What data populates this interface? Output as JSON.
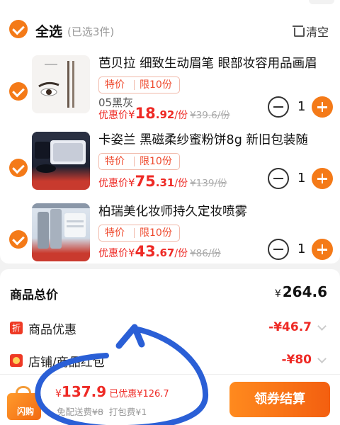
{
  "cart": {
    "select_all_label": "全选",
    "selected_count": "(已选3件)",
    "clear_label": "清空",
    "items": [
      {
        "title": "芭贝拉 细致生动眉笔 眼部妆容用品画眉",
        "tag_special": "特价",
        "tag_limit": "限10份",
        "variant": "05黑灰",
        "price_prefix": "优惠价",
        "yen": "¥",
        "price_int": "18",
        "price_dec": ".92",
        "unit": "/份",
        "original": "¥39.6/份",
        "quantity": "1"
      },
      {
        "title": "卡姿兰 黑磁柔纱蜜粉饼8g 新旧包装随",
        "tag_special": "特价",
        "tag_limit": "限10份",
        "variant": "",
        "price_prefix": "优惠价",
        "yen": "¥",
        "price_int": "75",
        "price_dec": ".31",
        "unit": "/份",
        "original": "¥139/份",
        "quantity": "1"
      },
      {
        "title": "柏瑞美化妆师持久定妆喷雾",
        "tag_special": "特价",
        "tag_limit": "限10份",
        "variant": "",
        "price_prefix": "优惠价",
        "yen": "¥",
        "price_int": "43",
        "price_dec": ".67",
        "unit": "/份",
        "original": "¥86/份",
        "quantity": "1"
      }
    ]
  },
  "summary": {
    "total_label": "商品总价",
    "total_yen": "¥",
    "total_value": "264.6",
    "discount_badge": "折",
    "discount_label": "商品优惠",
    "discount_value": "-¥46.7",
    "redpacket_label": "店铺/商品红包",
    "redpacket_value": "-¥80"
  },
  "bottom_bar": {
    "bag_text": "闪购",
    "yen": "¥",
    "total": "137.9",
    "saved": "已优惠¥126.7",
    "shipping_label": "免配送费",
    "shipping_original": "¥8",
    "packing": "打包费¥1",
    "checkout_label": "领券结算"
  },
  "colors": {
    "accent": "#f47a18",
    "price_red": "#ee2a25",
    "annotation_blue": "#2a5fd6"
  }
}
